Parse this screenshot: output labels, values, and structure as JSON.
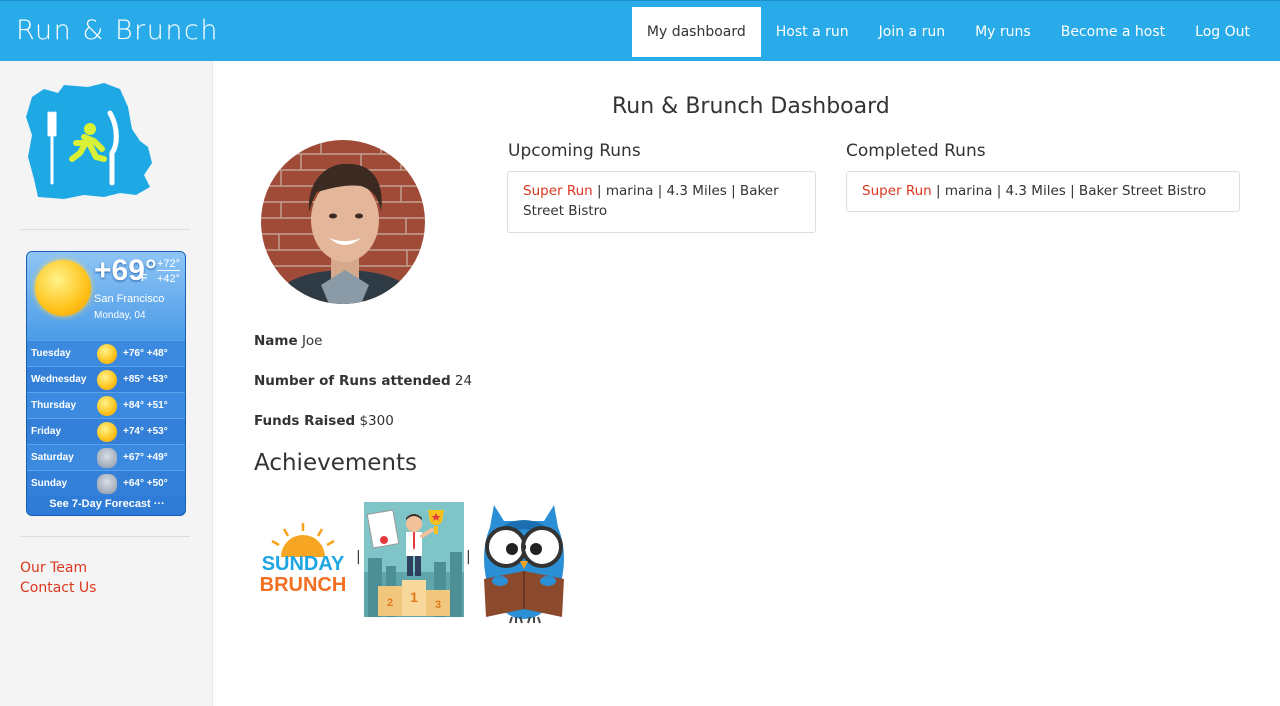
{
  "app": {
    "brand": "Run & Brunch"
  },
  "nav": {
    "items": [
      {
        "label": "My dashboard",
        "active": true
      },
      {
        "label": "Host a run",
        "active": false
      },
      {
        "label": "Join a run",
        "active": false
      },
      {
        "label": "My runs",
        "active": false
      },
      {
        "label": "Become a host",
        "active": false
      },
      {
        "label": "Log Out",
        "active": false
      }
    ]
  },
  "sidebar": {
    "logo_icon": "fork-runner-knife-logo",
    "weather": {
      "temp": "+69°",
      "unit": "F",
      "high": "+72°",
      "low": "+42°",
      "city": "San Francisco",
      "date": "Monday, 04",
      "forecast": [
        {
          "day": "Tuesday",
          "icon": "sunny",
          "temps": "+76° +48°"
        },
        {
          "day": "Wednesday",
          "icon": "sunny",
          "temps": "+85° +53°"
        },
        {
          "day": "Thursday",
          "icon": "sunny",
          "temps": "+84° +51°"
        },
        {
          "day": "Friday",
          "icon": "sunny",
          "temps": "+74° +53°"
        },
        {
          "day": "Saturday",
          "icon": "rain",
          "temps": "+67° +49°"
        },
        {
          "day": "Sunday",
          "icon": "rain",
          "temps": "+64° +50°"
        }
      ],
      "footer": "See 7-Day Forecast ···"
    },
    "links": [
      "Our Team",
      "Contact Us"
    ]
  },
  "main": {
    "title": "Run & Brunch Dashboard",
    "upcoming": {
      "heading": "Upcoming Runs",
      "runs": [
        {
          "name": "Super Run",
          "details": " | marina | 4.3 Miles | Baker Street Bistro"
        }
      ]
    },
    "completed": {
      "heading": "Completed Runs",
      "runs": [
        {
          "name": "Super Run",
          "details": " | marina | 4.3 Miles | Baker Street Bistro"
        }
      ]
    },
    "profile": {
      "name_label": "Name",
      "name": "Joe",
      "runs_label": "Number of Runs attended",
      "runs": "24",
      "funds_label": "Funds Raised",
      "funds": "$300"
    },
    "achievements": {
      "title": "Achievements",
      "separator": "|",
      "badges": [
        {
          "name": "sunday-brunch-badge",
          "line1": "SUNDAY",
          "line2": "BRUNCH"
        },
        {
          "name": "podium-trophy-badge",
          "places": [
            "2",
            "1",
            "3"
          ]
        },
        {
          "name": "owl-reader-badge"
        }
      ]
    }
  },
  "colors": {
    "nav_bg": "#29abe9",
    "link": "#d9381e",
    "sidebar_bg": "#f4f4f4"
  }
}
